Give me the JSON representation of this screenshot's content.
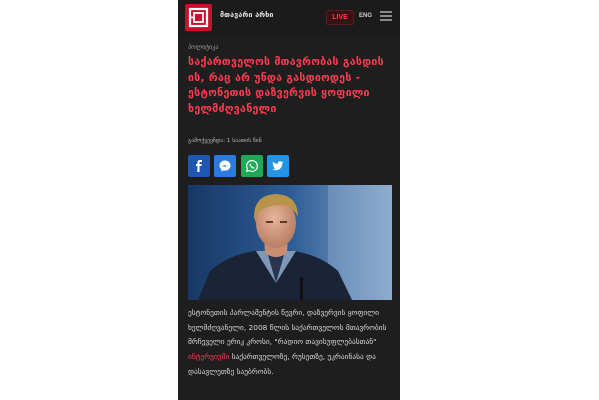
{
  "header": {
    "brand": "მთავარი არხი",
    "live_label": "LIVE",
    "lang_label": "ENG",
    "menu_icon": "hamburger-menu-icon",
    "logo_icon": "mtavari-logo-icon"
  },
  "article": {
    "category": "პოლიტიკა",
    "headline": "საქართველოს მთავრობას გასდის ის, რაც არ უნდა გასდიოდეს - ესტონეთის დაზვერვის ყოფილი ხელმძღვანელი",
    "date": "გამოქვეყნდა: 1 საათის წინ",
    "body_text": "ესტონეთის პარლამენტის წევრი, დაზვერვის ყოფილი ხელმძღვანელი, 2008 წლის საქართველოს მთავრობის მრჩეველი ერიკ კროსი, \"რადიო თავისუფლებასთან\"",
    "body_link": "ინტერვიუში",
    "body_text_after": " საქართველოზე, რუსეთზე, უკრაინასა და დასავლეთზე საუბრობს."
  },
  "share": [
    {
      "name": "facebook",
      "icon": "facebook-icon"
    },
    {
      "name": "messenger",
      "icon": "messenger-icon"
    },
    {
      "name": "whatsapp",
      "icon": "whatsapp-icon"
    },
    {
      "name": "twitter",
      "icon": "twitter-icon"
    }
  ],
  "colors": {
    "accent": "#ff3c52",
    "background": "#1e1e1e",
    "logo_red": "#c8102e"
  }
}
